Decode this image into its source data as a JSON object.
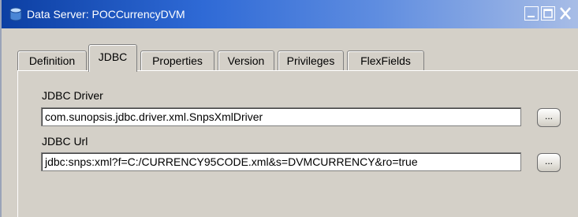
{
  "window": {
    "title": "Data Server: POCCurrencyDVM",
    "controls": {
      "minimize": "minimize-icon",
      "maximize": "maximize-icon",
      "close": "close-icon"
    }
  },
  "tabs": [
    {
      "label": "Definition",
      "active": false
    },
    {
      "label": "JDBC",
      "active": true
    },
    {
      "label": "Properties",
      "active": false
    },
    {
      "label": "Version",
      "active": false
    },
    {
      "label": "Privileges",
      "active": false
    },
    {
      "label": "FlexFields",
      "active": false
    }
  ],
  "jdbc": {
    "driver_label": "JDBC Driver",
    "driver_value": "com.sunopsis.jdbc.driver.xml.SnpsXmlDriver",
    "url_label": "JDBC Url",
    "url_value": "jdbc:snps:xml?f=C:/CURRENCY95CODE.xml&s=DVMCURRENCY&ro=true",
    "browse_label": "..."
  },
  "colors": {
    "titlebar_start": "#0c3fa3",
    "titlebar_end": "#a8bde6",
    "panel_background": "#d4d0c8"
  }
}
